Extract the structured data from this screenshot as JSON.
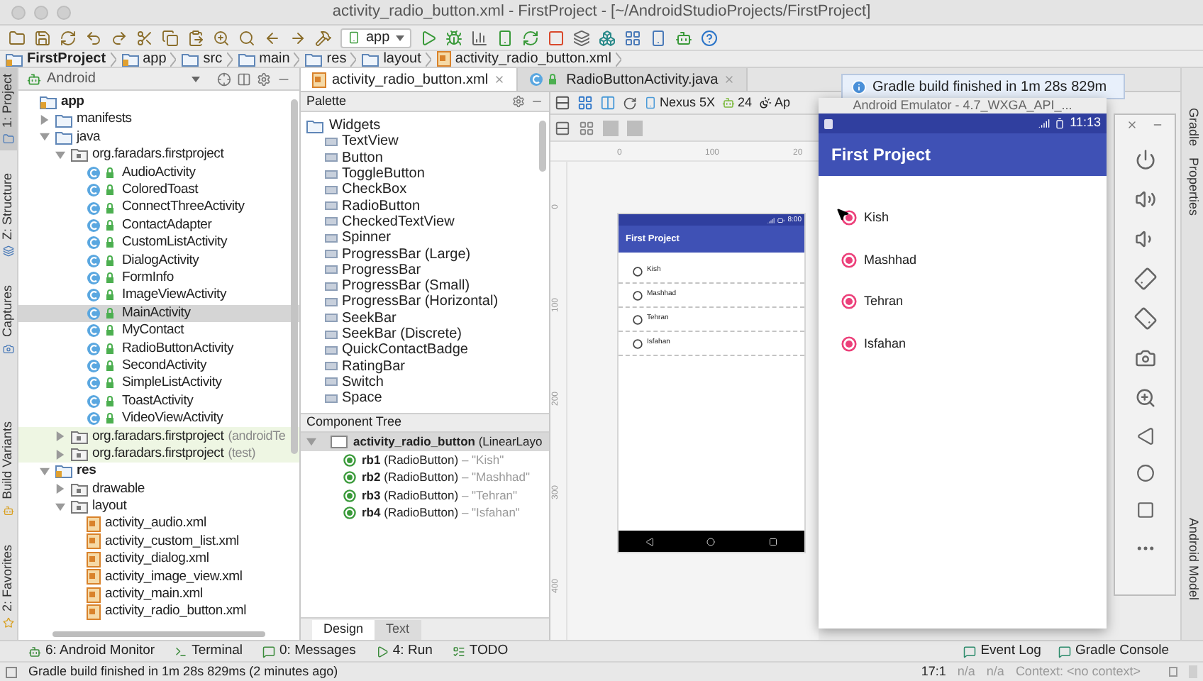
{
  "window": {
    "title": "activity_radio_button.xml - FirstProject - [~/AndroidStudioProjects/FirstProject]"
  },
  "toolbar": {
    "run_config": "app"
  },
  "breadcrumbs": [
    {
      "label": "FirstProject",
      "kind": "project"
    },
    {
      "label": "app",
      "kind": "module"
    },
    {
      "label": "src",
      "kind": "folder"
    },
    {
      "label": "main",
      "kind": "folder"
    },
    {
      "label": "res",
      "kind": "folder"
    },
    {
      "label": "layout",
      "kind": "folder"
    },
    {
      "label": "activity_radio_button.xml",
      "kind": "file"
    }
  ],
  "left_strip_top": [
    {
      "label": "1: Project",
      "selected": true
    },
    {
      "label": "Z: Structure",
      "selected": false
    },
    {
      "label": "Captures",
      "selected": false
    }
  ],
  "left_strip_bottom": [
    {
      "label": "Build Variants",
      "selected": false
    },
    {
      "label": "2: Favorites",
      "selected": false
    }
  ],
  "project_panel": {
    "view": "Android",
    "tree": [
      {
        "label": "app",
        "kind": "module",
        "selected": false,
        "children": [
          {
            "label": "manifests",
            "kind": "folder",
            "expanded": false,
            "selected": false
          },
          {
            "label": "java",
            "kind": "folder",
            "expanded": true,
            "selected": false,
            "children": [
              {
                "label": "org.faradars.firstproject",
                "kind": "package",
                "expanded": true,
                "selected": false,
                "children": [
                  {
                    "label": "AudioActivity",
                    "kind": "class",
                    "selected": false
                  },
                  {
                    "label": "ColoredToast",
                    "kind": "class",
                    "selected": false
                  },
                  {
                    "label": "ConnectThreeActivity",
                    "kind": "class",
                    "selected": false
                  },
                  {
                    "label": "ContactAdapter",
                    "kind": "class",
                    "selected": false
                  },
                  {
                    "label": "CustomListActivity",
                    "kind": "class",
                    "selected": false
                  },
                  {
                    "label": "DialogActivity",
                    "kind": "class",
                    "selected": false
                  },
                  {
                    "label": "FormInfo",
                    "kind": "class",
                    "selected": false
                  },
                  {
                    "label": "ImageViewActivity",
                    "kind": "class",
                    "selected": false
                  },
                  {
                    "label": "MainActivity",
                    "kind": "class",
                    "selected": true
                  },
                  {
                    "label": "MyContact",
                    "kind": "class",
                    "selected": false
                  },
                  {
                    "label": "RadioButtonActivity",
                    "kind": "class",
                    "selected": false
                  },
                  {
                    "label": "SecondActivity",
                    "kind": "class",
                    "selected": false
                  },
                  {
                    "label": "SimpleListActivity",
                    "kind": "class",
                    "selected": false
                  },
                  {
                    "label": "ToastActivity",
                    "kind": "class",
                    "selected": false
                  },
                  {
                    "label": "VideoViewActivity",
                    "kind": "class",
                    "selected": false
                  }
                ]
              },
              {
                "label": "org.faradars.firstproject",
                "suffix": "(androidTe",
                "kind": "test-package",
                "expanded": false,
                "selected": false
              },
              {
                "label": "org.faradars.firstproject",
                "suffix": "(test)",
                "kind": "test-package",
                "expanded": false,
                "selected": false
              }
            ]
          },
          {
            "label": "res",
            "kind": "module",
            "expanded": true,
            "selected": false,
            "children": [
              {
                "label": "drawable",
                "kind": "package",
                "expanded": false,
                "selected": false
              },
              {
                "label": "layout",
                "kind": "package",
                "expanded": true,
                "selected": false,
                "children": [
                  {
                    "label": "activity_audio.xml",
                    "kind": "layout-file",
                    "selected": false
                  },
                  {
                    "label": "activity_custom_list.xml",
                    "kind": "layout-file",
                    "selected": false
                  },
                  {
                    "label": "activity_dialog.xml",
                    "kind": "layout-file",
                    "selected": false
                  },
                  {
                    "label": "activity_image_view.xml",
                    "kind": "layout-file",
                    "selected": false
                  },
                  {
                    "label": "activity_main.xml",
                    "kind": "layout-file",
                    "selected": false
                  },
                  {
                    "label": "activity_radio_button.xml",
                    "kind": "layout-file",
                    "selected": false
                  }
                ]
              }
            ]
          }
        ]
      }
    ]
  },
  "editor_tabs": [
    {
      "label": "activity_radio_button.xml",
      "kind": "xml",
      "selected": true
    },
    {
      "label": "RadioButtonActivity.java",
      "kind": "java",
      "selected": false
    }
  ],
  "palette": {
    "title": "Palette",
    "group": "Widgets",
    "items": [
      "TextView",
      "Button",
      "ToggleButton",
      "CheckBox",
      "RadioButton",
      "CheckedTextView",
      "Spinner",
      "ProgressBar (Large)",
      "ProgressBar",
      "ProgressBar (Small)",
      "ProgressBar (Horizontal)",
      "SeekBar",
      "SeekBar (Discrete)",
      "QuickContactBadge",
      "RatingBar",
      "Switch",
      "Space"
    ]
  },
  "component_tree": {
    "title": "Component Tree",
    "root": {
      "name": "activity_radio_button",
      "type": "(LinearLayo",
      "expanded": true
    },
    "children": [
      {
        "id": "rb1",
        "type": "(RadioButton)",
        "text": "– \"Kish\""
      },
      {
        "id": "rb2",
        "type": "(RadioButton)",
        "text": "– \"Mashhad\""
      },
      {
        "id": "rb3",
        "type": "(RadioButton)",
        "text": "– \"Tehran\""
      },
      {
        "id": "rb4",
        "type": "(RadioButton)",
        "text": "– \"Isfahan\""
      }
    ]
  },
  "design_tabs": [
    {
      "label": "Design",
      "selected": true
    },
    {
      "label": "Text",
      "selected": false
    }
  ],
  "design_toolbar": {
    "device": "Nexus 5X",
    "api": "24",
    "theme": "Ap"
  },
  "rulers": {
    "horizontal": [
      "0",
      "100",
      "20"
    ],
    "vertical": [
      "0",
      "100",
      "200",
      "300",
      "400"
    ]
  },
  "preview": {
    "time": "8:00",
    "app_title": "First Project",
    "radios": [
      {
        "label": "Kish",
        "checked": false
      },
      {
        "label": "Mashhad",
        "checked": false
      },
      {
        "label": "Tehran",
        "checked": false
      },
      {
        "label": "Isfahan",
        "checked": false
      }
    ]
  },
  "notification": {
    "text": "Gradle build finished in 1m 28s 829m"
  },
  "emulator": {
    "title": "Android Emulator - 4.7_WXGA_API_...",
    "time": "11:13",
    "app_title": "First Project",
    "radios": [
      {
        "label": "Kish",
        "checked": true
      },
      {
        "label": "Mashhad",
        "checked": true
      },
      {
        "label": "Tehran",
        "checked": true
      },
      {
        "label": "Isfahan",
        "checked": true
      }
    ]
  },
  "right_strip_top": [
    "Gradle",
    "Properties"
  ],
  "right_strip_bottom": [
    "Android Model"
  ],
  "tool_windows_left": [
    "6: Android Monitor",
    "Terminal",
    "0: Messages",
    "4: Run",
    "TODO"
  ],
  "tool_windows_right": [
    "Event Log",
    "Gradle Console"
  ],
  "status_bar": {
    "message": "Gradle build finished in 1m 28s 829ms (2 minutes ago)",
    "position": "17:1",
    "column_3": "n/a",
    "column_4": "n/a",
    "context": "Context: <no context>"
  }
}
